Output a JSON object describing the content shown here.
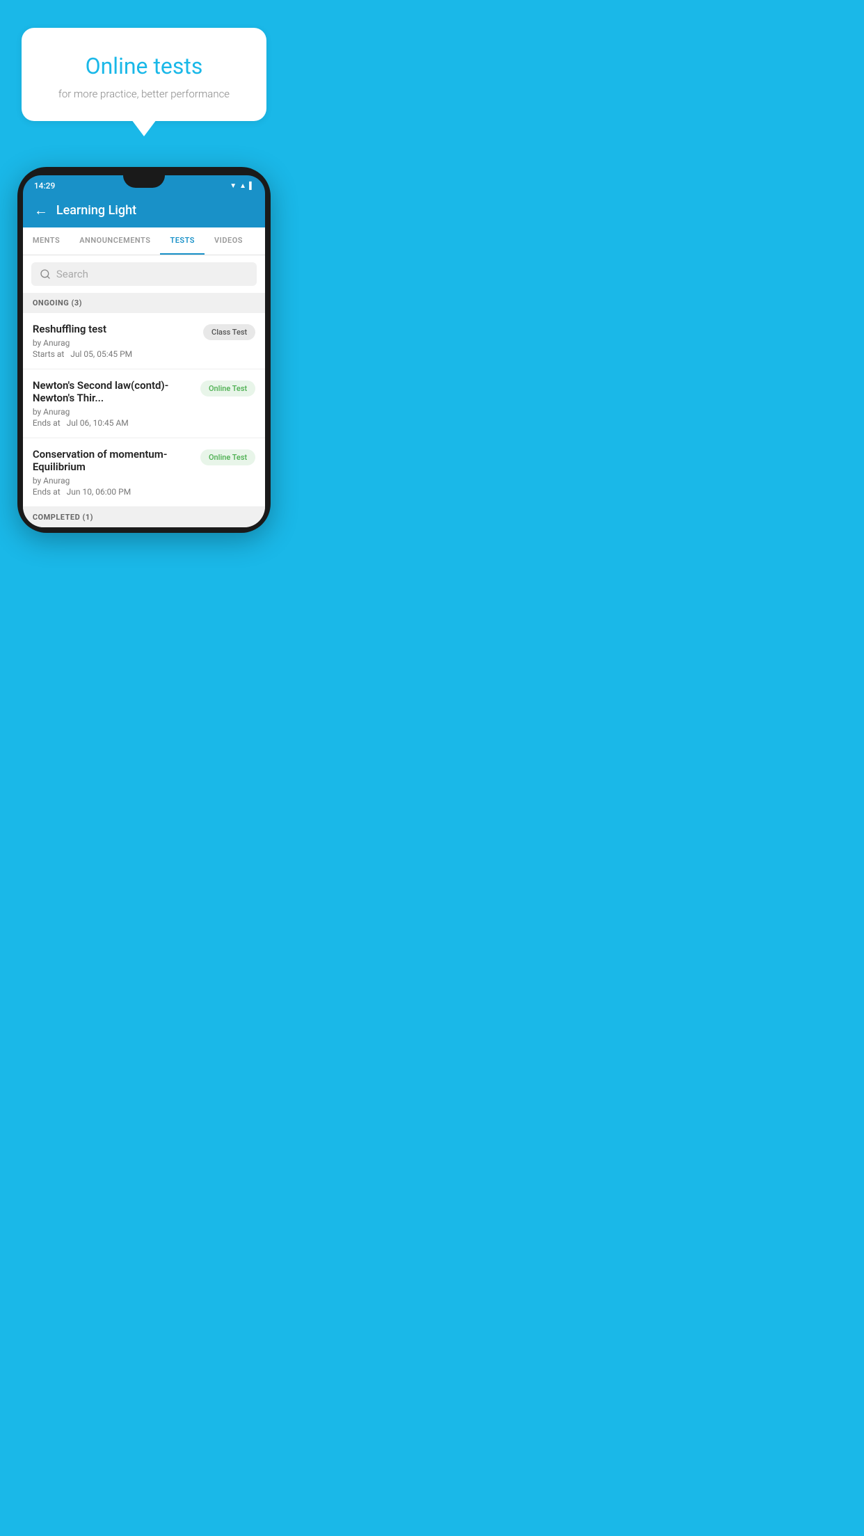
{
  "background_color": "#1ab8e8",
  "bubble": {
    "title": "Online tests",
    "subtitle": "for more practice, better performance"
  },
  "phone": {
    "status_bar": {
      "time": "14:29",
      "icons": [
        "wifi",
        "signal",
        "battery"
      ]
    },
    "header": {
      "back_label": "←",
      "title": "Learning Light"
    },
    "tabs": [
      {
        "label": "MENTS",
        "active": false
      },
      {
        "label": "ANNOUNCEMENTS",
        "active": false
      },
      {
        "label": "TESTS",
        "active": true
      },
      {
        "label": "VIDEOS",
        "active": false
      }
    ],
    "search": {
      "placeholder": "Search"
    },
    "ongoing_section": {
      "label": "ONGOING (3)"
    },
    "tests": [
      {
        "title": "Reshuffling test",
        "author": "by Anurag",
        "time_label": "Starts at",
        "time": "Jul 05, 05:45 PM",
        "badge": "Class Test",
        "badge_type": "class"
      },
      {
        "title": "Newton's Second law(contd)-Newton's Thir...",
        "author": "by Anurag",
        "time_label": "Ends at",
        "time": "Jul 06, 10:45 AM",
        "badge": "Online Test",
        "badge_type": "online"
      },
      {
        "title": "Conservation of momentum-Equilibrium",
        "author": "by Anurag",
        "time_label": "Ends at",
        "time": "Jun 10, 06:00 PM",
        "badge": "Online Test",
        "badge_type": "online"
      }
    ],
    "completed_section": {
      "label": "COMPLETED (1)"
    }
  }
}
